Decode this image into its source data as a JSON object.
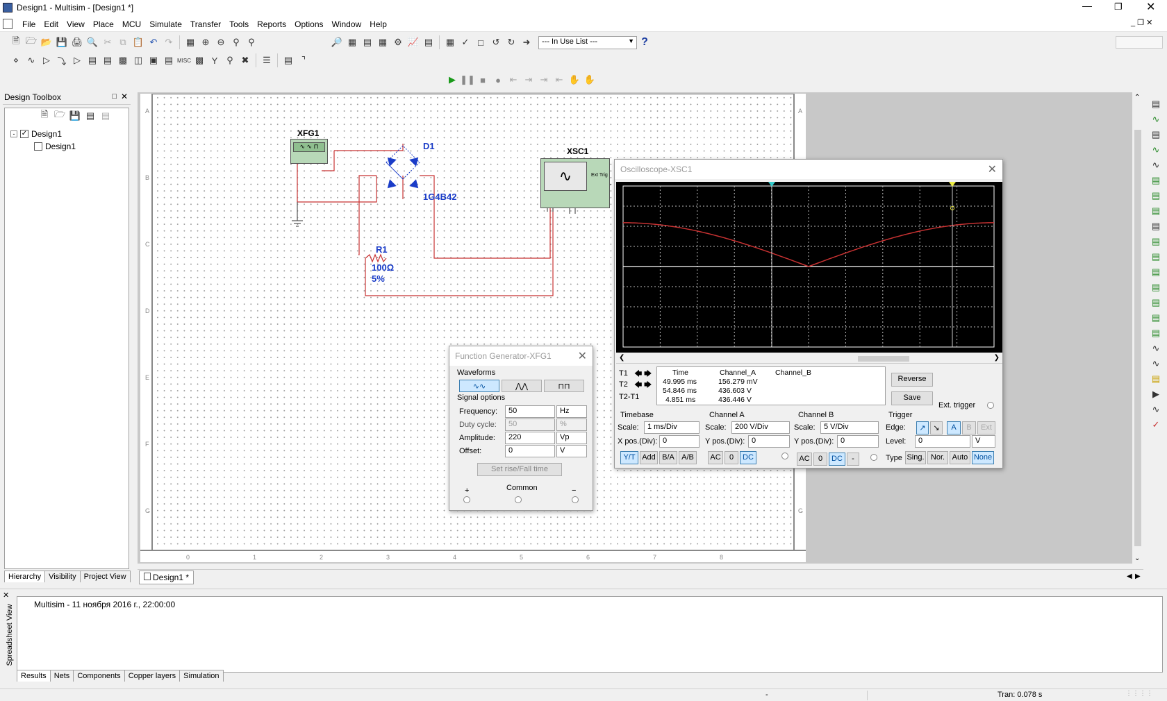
{
  "window": {
    "title": "Design1 - Multisim - [Design1 *]"
  },
  "menu": [
    "File",
    "Edit",
    "View",
    "Place",
    "MCU",
    "Simulate",
    "Transfer",
    "Tools",
    "Reports",
    "Options",
    "Window",
    "Help"
  ],
  "toolbar": {
    "in_use_list": "--- In Use List ---",
    "help": "?"
  },
  "toolbox": {
    "title": "Design Toolbox",
    "tree": {
      "root": "Design1",
      "child": "Design1"
    },
    "tabs": [
      "Hierarchy",
      "Visibility",
      "Project View"
    ]
  },
  "schematic": {
    "xfg1": "XFG1",
    "d1": "D1",
    "d1_model": "1G4B42",
    "xsc1": "XSC1",
    "ext_trig": "Ext Trig",
    "r1": "R1",
    "r1_value": "100Ω",
    "r1_tol": "5%",
    "row_labels": [
      "A",
      "B",
      "C",
      "D",
      "E",
      "F",
      "G"
    ],
    "col_labels": [
      "0",
      "1",
      "2",
      "3",
      "4",
      "5",
      "6",
      "7",
      "8"
    ],
    "tab": "Design1 *"
  },
  "fgen": {
    "title": "Function Generator-XFG1",
    "waveforms": "Waveforms",
    "signal_options": "Signal options",
    "rows": [
      {
        "label": "Frequency:",
        "value": "50",
        "unit": "Hz"
      },
      {
        "label": "Duty cycle:",
        "value": "50",
        "unit": "%"
      },
      {
        "label": "Amplitude:",
        "value": "220",
        "unit": "Vp"
      },
      {
        "label": "Offset:",
        "value": "0",
        "unit": "V"
      }
    ],
    "rise_fall": "Set rise/Fall time",
    "plus": "+",
    "common": "Common",
    "minus": "−"
  },
  "scope": {
    "title": "Oscilloscope-XSC1",
    "meas_headers": {
      "time": "Time",
      "cha": "Channel_A",
      "chb": "Channel_B"
    },
    "meas": [
      {
        "row": "T1",
        "time": "49.995 ms",
        "cha": "156.279 mV",
        "chb": ""
      },
      {
        "row": "T2",
        "time": "54.846 ms",
        "cha": "436.603 V",
        "chb": ""
      },
      {
        "row": "T2-T1",
        "time": "4.851 ms",
        "cha": "436.446 V",
        "chb": ""
      }
    ],
    "reverse": "Reverse",
    "save": "Save",
    "ext_trigger": "Ext. trigger",
    "timebase": {
      "title": "Timebase",
      "scale_label": "Scale:",
      "scale": "1 ms/Div",
      "xpos_label": "X pos.(Div):",
      "xpos": "0",
      "modes": [
        "Y/T",
        "Add",
        "B/A",
        "A/B"
      ]
    },
    "cha": {
      "title": "Channel A",
      "scale_label": "Scale:",
      "scale": "200  V/Div",
      "ypos_label": "Y pos.(Div):",
      "ypos": "0",
      "modes": [
        "AC",
        "0",
        "DC"
      ]
    },
    "chb": {
      "title": "Channel B",
      "scale_label": "Scale:",
      "scale": "5  V/Div",
      "ypos_label": "Y pos.(Div):",
      "ypos": "0",
      "modes": [
        "AC",
        "0",
        "DC",
        "-"
      ]
    },
    "trigger": {
      "title": "Trigger",
      "edge_label": "Edge:",
      "edges": [
        "↗",
        "↘",
        "A",
        "B",
        "Ext"
      ],
      "level_label": "Level:",
      "level": "0",
      "level_unit": "V",
      "type_label": "Type",
      "types": [
        "Sing.",
        "Nor.",
        "Auto",
        "None"
      ]
    }
  },
  "output": {
    "side_label": "Spreadsheet View",
    "log": "Multisim  -  11 ноября 2016 г., 22:00:00",
    "tabs": [
      "Results",
      "Nets",
      "Components",
      "Copper layers",
      "Simulation"
    ]
  },
  "status": {
    "dash": "-",
    "tran": "Tran: 0.078 s"
  },
  "colors": {
    "wire": "#c83232",
    "diode": "#1a3cc8",
    "instrument": "#b8d8b8",
    "trace": "#c83232"
  }
}
